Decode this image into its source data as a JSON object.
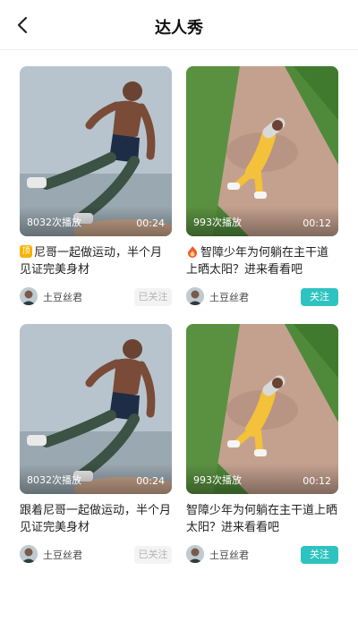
{
  "header": {
    "title": "达人秀"
  },
  "cards": [
    {
      "plays": "8032次播放",
      "duration": "00:24",
      "caption": "尼哥一起做运动，半个月见证完美身材",
      "tag": "yellow-top-tag-icon",
      "author": "土豆丝君",
      "follow_label": "已关注",
      "follow_state": "followed"
    },
    {
      "plays": "993次播放",
      "duration": "00:12",
      "caption": "智障少年为何躺在主干道上晒太阳？进来看看吧",
      "tag": "flame-icon",
      "author": "土豆丝君",
      "follow_label": "关注",
      "follow_state": "not-followed"
    },
    {
      "plays": "8032次播放",
      "duration": "00:24",
      "caption": "跟着尼哥一起做运动，半个月见证完美身材",
      "tag": "",
      "author": "土豆丝君",
      "follow_label": "已关注",
      "follow_state": "followed"
    },
    {
      "plays": "993次播放",
      "duration": "00:12",
      "caption": "智障少年为何躺在主干道上晒太阳？进来看看吧",
      "tag": "",
      "author": "土豆丝君",
      "follow_label": "关注",
      "follow_state": "not-followed"
    }
  ],
  "colors": {
    "accent": "#2ec3c1",
    "followed_bg": "#f3f3f3",
    "tag_yellow": "#f4b400",
    "flame": "#f05a28"
  }
}
